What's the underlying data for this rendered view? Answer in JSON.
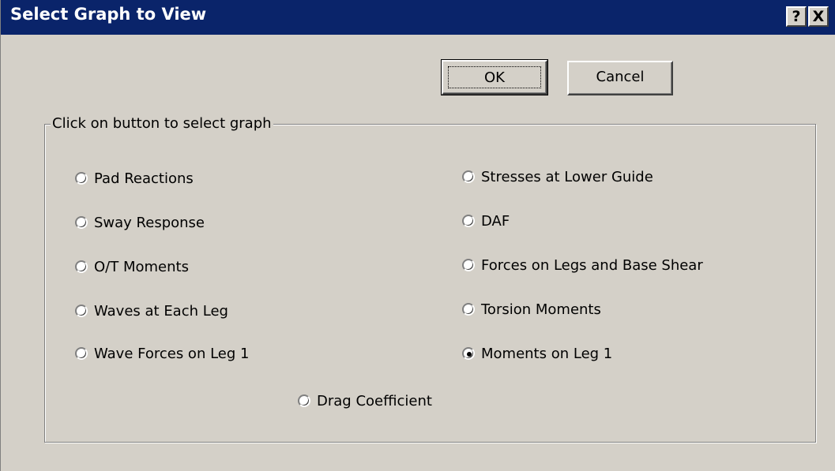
{
  "window": {
    "title": "Select Graph to View",
    "help_label": "?",
    "close_label": "X"
  },
  "buttons": {
    "ok_label": "OK",
    "cancel_label": "Cancel"
  },
  "group": {
    "title": "Click on button to select graph",
    "options": [
      {
        "label": "Pad Reactions",
        "checked": false
      },
      {
        "label": "Sway Response",
        "checked": false
      },
      {
        "label": "O/T Moments",
        "checked": false
      },
      {
        "label": "Waves at Each Leg",
        "checked": false
      },
      {
        "label": "Wave Forces on Leg 1",
        "checked": false
      },
      {
        "label": "Stresses at Lower Guide",
        "checked": false
      },
      {
        "label": "DAF",
        "checked": false
      },
      {
        "label": "Forces on Legs and Base Shear",
        "checked": false
      },
      {
        "label": "Torsion Moments",
        "checked": false
      },
      {
        "label": "Moments on Leg 1",
        "checked": true
      },
      {
        "label": "Drag Coefficient",
        "checked": false
      }
    ]
  },
  "colors": {
    "titlebar": "#0a246a",
    "face": "#d4d0c8"
  }
}
